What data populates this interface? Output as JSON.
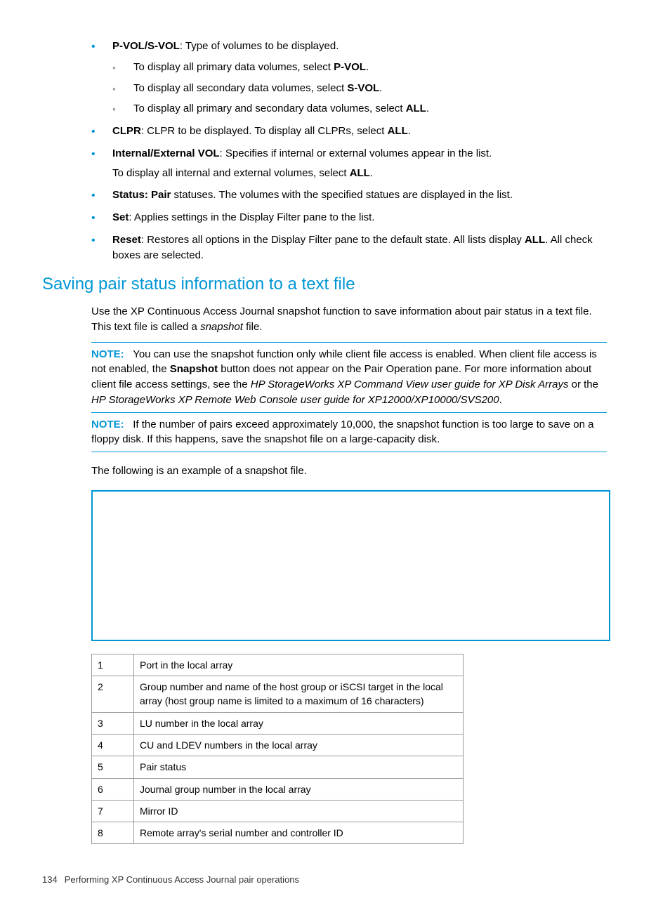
{
  "list": {
    "pvol_svol": {
      "term": "P-VOL/S-VOL",
      "desc": ": Type of volumes to be displayed."
    },
    "sub": {
      "a": {
        "pre": "To display all primary data volumes, select ",
        "bold": "P-VOL",
        "post": "."
      },
      "b": {
        "pre": "To display all secondary data volumes, select ",
        "bold": "S-VOL",
        "post": "."
      },
      "c": {
        "pre": "To display all primary and secondary data volumes, select ",
        "bold": "ALL",
        "post": "."
      }
    },
    "clpr": {
      "term": "CLPR",
      "mid": ": CLPR to be displayed. To display all CLPRs, select ",
      "bold": "ALL",
      "post": "."
    },
    "intext": {
      "term": "Internal/External VOL",
      "desc": ": Specifies if internal or external volumes appear in the list.",
      "line2_pre": "To display all internal and external volumes, select ",
      "line2_bold": "ALL",
      "line2_post": "."
    },
    "status": {
      "term": "Status: Pair",
      "desc": " statuses. The volumes with the specified statues are displayed in the list."
    },
    "set": {
      "term": "Set",
      "desc": ": Applies settings in the Display Filter pane to the list."
    },
    "reset": {
      "term": "Reset",
      "mid": ": Restores all options in the Display Filter pane to the default state. All lists display ",
      "bold": "ALL",
      "post": ". All check boxes are selected."
    }
  },
  "heading": "Saving pair status information to a text file",
  "intro": {
    "p1a": "Use the XP Continuous Access Journal snapshot function to save information about pair status in a text file. This text file is called a ",
    "p1i": "snapshot",
    "p1b": " file."
  },
  "note1": {
    "label": "NOTE:",
    "a": "You can use the snapshot function only while client file access is enabled. When client file access is not enabled, the ",
    "b_bold": "Snapshot",
    "c": " button does not appear on the Pair Operation pane. For more information about client file access settings, see the ",
    "d_i": "HP StorageWorks XP Command View user guide for XP Disk Arrays",
    "e": " or the ",
    "f_i": "HP StorageWorks XP Remote Web Console user guide for XP12000/XP10000/SVS200",
    "g": "."
  },
  "note2": {
    "label": "NOTE:",
    "text": "If the number of pairs exceed approximately 10,000, the snapshot function is too large to save on a floppy disk. If this happens, save the snapshot file on a large-capacity disk."
  },
  "example_line": "The following is an example of a snapshot file.",
  "table": [
    {
      "n": "1",
      "d": "Port in the local array"
    },
    {
      "n": "2",
      "d": "Group number and name of the host group or iSCSI target in the local array (host group name is limited to a maximum of 16 characters)"
    },
    {
      "n": "3",
      "d": "LU number in the local array"
    },
    {
      "n": "4",
      "d": "CU and LDEV numbers in the local array"
    },
    {
      "n": "5",
      "d": "Pair status"
    },
    {
      "n": "6",
      "d": "Journal group number in the local array"
    },
    {
      "n": "7",
      "d": "Mirror ID"
    },
    {
      "n": "8",
      "d": "Remote array's serial number and controller ID"
    }
  ],
  "footer": {
    "page": "134",
    "title": "Performing XP Continuous Access Journal pair operations"
  }
}
